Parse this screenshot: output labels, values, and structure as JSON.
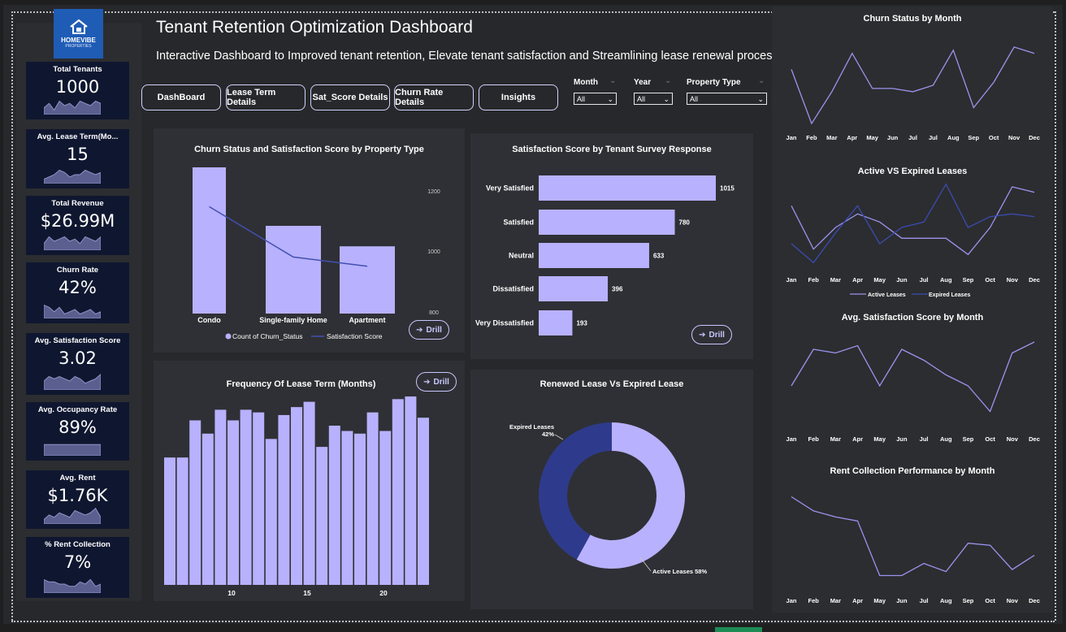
{
  "header": {
    "title": "Tenant Retention Optimization Dashboard",
    "subtitle": "Interactive Dashboard to Improved tenant retention, Elevate tenant satisfaction and  Streamlining lease renewal processes"
  },
  "logo": {
    "brand": "HOMEVIBE",
    "sub": "PROPERTIES"
  },
  "nav": [
    "DashBoard",
    "Lease Term Details",
    "Sat_Score Details",
    "Churn Rate Details",
    "Insights"
  ],
  "filters": [
    {
      "label": "Month",
      "value": "All"
    },
    {
      "label": "Year",
      "value": "All"
    },
    {
      "label": "Property Type",
      "value": "All"
    }
  ],
  "kpis": [
    {
      "label": "Total Tenants",
      "value": "1000",
      "spark": [
        3,
        5,
        2,
        6,
        4,
        5,
        3,
        6,
        5,
        4,
        6,
        5
      ]
    },
    {
      "label": "Avg. Lease Term(Mo...",
      "value": "15",
      "spark": [
        2,
        3,
        4,
        6,
        5,
        3,
        4,
        4,
        6,
        5,
        4,
        5
      ]
    },
    {
      "label": "Total Revenue",
      "value": "$26.99M",
      "spark": [
        3,
        6,
        4,
        5,
        6,
        4,
        5,
        3,
        6,
        5,
        4,
        6
      ]
    },
    {
      "label": "Churn Rate",
      "value": "42%",
      "spark": [
        6,
        5,
        3,
        5,
        2,
        3,
        4,
        2,
        3,
        4,
        2,
        3
      ]
    },
    {
      "label": "Avg. Satisfaction Score",
      "value": "3.02",
      "spark": [
        4,
        6,
        5,
        6,
        5,
        4,
        6,
        5,
        3,
        4,
        5,
        7
      ]
    },
    {
      "label": "Avg. Occupancy Rate",
      "value": "89%",
      "spark": [
        5,
        5,
        5,
        5,
        5,
        5,
        5,
        5,
        5,
        5,
        5,
        5
      ]
    },
    {
      "label": "Avg. Rent",
      "value": "$1.76K",
      "spark": [
        2,
        4,
        3,
        5,
        4,
        3,
        6,
        5,
        4,
        5,
        7,
        3
      ]
    },
    {
      "label": "% Rent Collection",
      "value": "7%",
      "spark": [
        6,
        5,
        5,
        4,
        4,
        3,
        3,
        5,
        4,
        6,
        3,
        4
      ]
    }
  ],
  "drill_label": "Drill",
  "colors": {
    "bar": "#b8b1fd",
    "line": "#4250b0",
    "dark_slice": "#2e3b8c",
    "kpi_bg": "#0f1730",
    "logo": "#1f5cb5"
  },
  "chart_data": [
    {
      "type": "bar",
      "title": "Churn Status and Satisfaction Score by Property Type",
      "categories": [
        "Condo",
        "Single-family Home",
        "Apartment"
      ],
      "series": [
        {
          "name": "Count of Churn_Status",
          "values": [
            1300,
            1100,
            1030
          ]
        },
        {
          "name": "Satisfaction Score",
          "values": [
            1150,
            985,
            955
          ],
          "kind": "line"
        }
      ],
      "secondary_axis_ticks": [
        "1200",
        "1000",
        "800"
      ],
      "legend": "bottom"
    },
    {
      "type": "bar",
      "orientation": "horizontal",
      "title": "Satisfaction Score by Tenant Survey Response",
      "categories": [
        "Very Satisfied",
        "Satisfied",
        "Neutral",
        "Dissatisfied",
        "Very Dissatisfied"
      ],
      "values": [
        1015,
        780,
        633,
        396,
        193
      ]
    },
    {
      "type": "bar",
      "title": "Frequency Of Lease Term (Months)",
      "x_ticks": [
        "10",
        "15",
        "20"
      ],
      "values": [
        48,
        48,
        62,
        57,
        66,
        62,
        66,
        65,
        55,
        64,
        67,
        69,
        52,
        60,
        58,
        57,
        65,
        58,
        70,
        71,
        63
      ]
    },
    {
      "type": "pie",
      "title": "Renewed Lease Vs Expired Lease",
      "slices": [
        {
          "label": "Active Leases 58%",
          "value": 58
        },
        {
          "label": "Expired Leases 42%",
          "value": 42
        }
      ],
      "labels": {
        "expired_line1": "Expired Leases",
        "expired_line2": "42%",
        "active": "Active Leases 58%"
      }
    },
    {
      "type": "line",
      "title": "Churn Status by Month",
      "categories": [
        "Jan",
        "Feb",
        "Mar",
        "Apr",
        "May",
        "Jun",
        "Jul",
        "Jul",
        "Aug",
        "Sep",
        "Oct",
        "Nov",
        "Dec"
      ],
      "values": [
        79,
        62,
        72,
        84,
        73,
        73,
        72,
        74,
        85,
        67,
        75,
        86,
        84
      ]
    },
    {
      "type": "line",
      "title": "Active VS Expired Leases",
      "categories": [
        "Jan",
        "Feb",
        "Mar",
        "Apr",
        "May",
        "Jun",
        "Jul",
        "Aug",
        "Sep",
        "Oct",
        "Nov",
        "Dec"
      ],
      "series": [
        {
          "name": "Active Leases",
          "values": [
            48,
            32,
            40,
            45,
            42,
            36,
            36,
            36,
            30,
            40,
            55,
            53
          ]
        },
        {
          "name": "Expired Leases",
          "values": [
            34,
            27,
            38,
            48,
            34,
            40,
            42,
            56,
            40,
            44,
            45,
            44
          ]
        }
      ],
      "legend": "bottom"
    },
    {
      "type": "line",
      "title": "Avg. Satisfaction Score  by Month",
      "categories": [
        "Jan",
        "Feb",
        "Mar",
        "Apr",
        "May",
        "Jun",
        "Jul",
        "Aug",
        "Sep",
        "Oct",
        "Nov",
        "Dec"
      ],
      "values": [
        3.0,
        3.1,
        3.09,
        3.11,
        3.0,
        3.1,
        3.07,
        3.03,
        3.0,
        2.93,
        3.09,
        3.12
      ]
    },
    {
      "type": "line",
      "title": "Rent Collection Performance  by Month",
      "categories": [
        "Jan",
        "Feb",
        "Mar",
        "Apr",
        "May",
        "Jun",
        "Jul",
        "Aug",
        "Sep",
        "Oct",
        "Nov",
        "Dec"
      ],
      "values": [
        9.0,
        8.3,
        8.0,
        7.8,
        5.1,
        5.1,
        5.7,
        5.3,
        6.7,
        6.6,
        5.4,
        6.1
      ]
    }
  ]
}
